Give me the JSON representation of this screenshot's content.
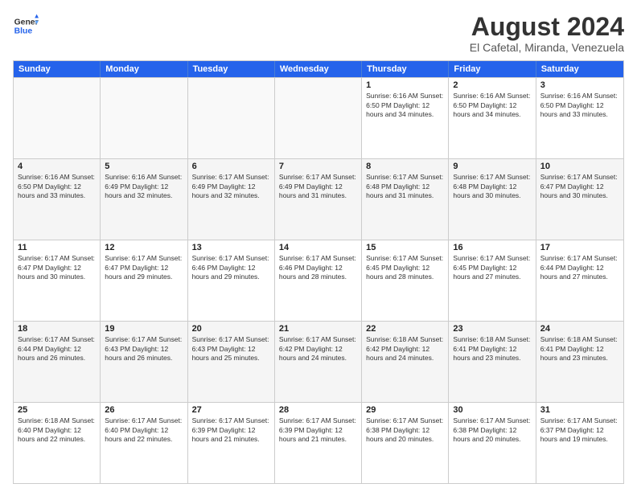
{
  "logo": {
    "general": "General",
    "blue": "Blue"
  },
  "title": "August 2024",
  "subtitle": "El Cafetal, Miranda, Venezuela",
  "days": [
    "Sunday",
    "Monday",
    "Tuesday",
    "Wednesday",
    "Thursday",
    "Friday",
    "Saturday"
  ],
  "rows": [
    [
      {
        "day": "",
        "info": ""
      },
      {
        "day": "",
        "info": ""
      },
      {
        "day": "",
        "info": ""
      },
      {
        "day": "",
        "info": ""
      },
      {
        "day": "1",
        "info": "Sunrise: 6:16 AM\nSunset: 6:50 PM\nDaylight: 12 hours\nand 34 minutes."
      },
      {
        "day": "2",
        "info": "Sunrise: 6:16 AM\nSunset: 6:50 PM\nDaylight: 12 hours\nand 34 minutes."
      },
      {
        "day": "3",
        "info": "Sunrise: 6:16 AM\nSunset: 6:50 PM\nDaylight: 12 hours\nand 33 minutes."
      }
    ],
    [
      {
        "day": "4",
        "info": "Sunrise: 6:16 AM\nSunset: 6:50 PM\nDaylight: 12 hours\nand 33 minutes."
      },
      {
        "day": "5",
        "info": "Sunrise: 6:16 AM\nSunset: 6:49 PM\nDaylight: 12 hours\nand 32 minutes."
      },
      {
        "day": "6",
        "info": "Sunrise: 6:17 AM\nSunset: 6:49 PM\nDaylight: 12 hours\nand 32 minutes."
      },
      {
        "day": "7",
        "info": "Sunrise: 6:17 AM\nSunset: 6:49 PM\nDaylight: 12 hours\nand 31 minutes."
      },
      {
        "day": "8",
        "info": "Sunrise: 6:17 AM\nSunset: 6:48 PM\nDaylight: 12 hours\nand 31 minutes."
      },
      {
        "day": "9",
        "info": "Sunrise: 6:17 AM\nSunset: 6:48 PM\nDaylight: 12 hours\nand 30 minutes."
      },
      {
        "day": "10",
        "info": "Sunrise: 6:17 AM\nSunset: 6:47 PM\nDaylight: 12 hours\nand 30 minutes."
      }
    ],
    [
      {
        "day": "11",
        "info": "Sunrise: 6:17 AM\nSunset: 6:47 PM\nDaylight: 12 hours\nand 30 minutes."
      },
      {
        "day": "12",
        "info": "Sunrise: 6:17 AM\nSunset: 6:47 PM\nDaylight: 12 hours\nand 29 minutes."
      },
      {
        "day": "13",
        "info": "Sunrise: 6:17 AM\nSunset: 6:46 PM\nDaylight: 12 hours\nand 29 minutes."
      },
      {
        "day": "14",
        "info": "Sunrise: 6:17 AM\nSunset: 6:46 PM\nDaylight: 12 hours\nand 28 minutes."
      },
      {
        "day": "15",
        "info": "Sunrise: 6:17 AM\nSunset: 6:45 PM\nDaylight: 12 hours\nand 28 minutes."
      },
      {
        "day": "16",
        "info": "Sunrise: 6:17 AM\nSunset: 6:45 PM\nDaylight: 12 hours\nand 27 minutes."
      },
      {
        "day": "17",
        "info": "Sunrise: 6:17 AM\nSunset: 6:44 PM\nDaylight: 12 hours\nand 27 minutes."
      }
    ],
    [
      {
        "day": "18",
        "info": "Sunrise: 6:17 AM\nSunset: 6:44 PM\nDaylight: 12 hours\nand 26 minutes."
      },
      {
        "day": "19",
        "info": "Sunrise: 6:17 AM\nSunset: 6:43 PM\nDaylight: 12 hours\nand 26 minutes."
      },
      {
        "day": "20",
        "info": "Sunrise: 6:17 AM\nSunset: 6:43 PM\nDaylight: 12 hours\nand 25 minutes."
      },
      {
        "day": "21",
        "info": "Sunrise: 6:17 AM\nSunset: 6:42 PM\nDaylight: 12 hours\nand 24 minutes."
      },
      {
        "day": "22",
        "info": "Sunrise: 6:18 AM\nSunset: 6:42 PM\nDaylight: 12 hours\nand 24 minutes."
      },
      {
        "day": "23",
        "info": "Sunrise: 6:18 AM\nSunset: 6:41 PM\nDaylight: 12 hours\nand 23 minutes."
      },
      {
        "day": "24",
        "info": "Sunrise: 6:18 AM\nSunset: 6:41 PM\nDaylight: 12 hours\nand 23 minutes."
      }
    ],
    [
      {
        "day": "25",
        "info": "Sunrise: 6:18 AM\nSunset: 6:40 PM\nDaylight: 12 hours\nand 22 minutes."
      },
      {
        "day": "26",
        "info": "Sunrise: 6:17 AM\nSunset: 6:40 PM\nDaylight: 12 hours\nand 22 minutes."
      },
      {
        "day": "27",
        "info": "Sunrise: 6:17 AM\nSunset: 6:39 PM\nDaylight: 12 hours\nand 21 minutes."
      },
      {
        "day": "28",
        "info": "Sunrise: 6:17 AM\nSunset: 6:39 PM\nDaylight: 12 hours\nand 21 minutes."
      },
      {
        "day": "29",
        "info": "Sunrise: 6:17 AM\nSunset: 6:38 PM\nDaylight: 12 hours\nand 20 minutes."
      },
      {
        "day": "30",
        "info": "Sunrise: 6:17 AM\nSunset: 6:38 PM\nDaylight: 12 hours\nand 20 minutes."
      },
      {
        "day": "31",
        "info": "Sunrise: 6:17 AM\nSunset: 6:37 PM\nDaylight: 12 hours\nand 19 minutes."
      }
    ]
  ]
}
